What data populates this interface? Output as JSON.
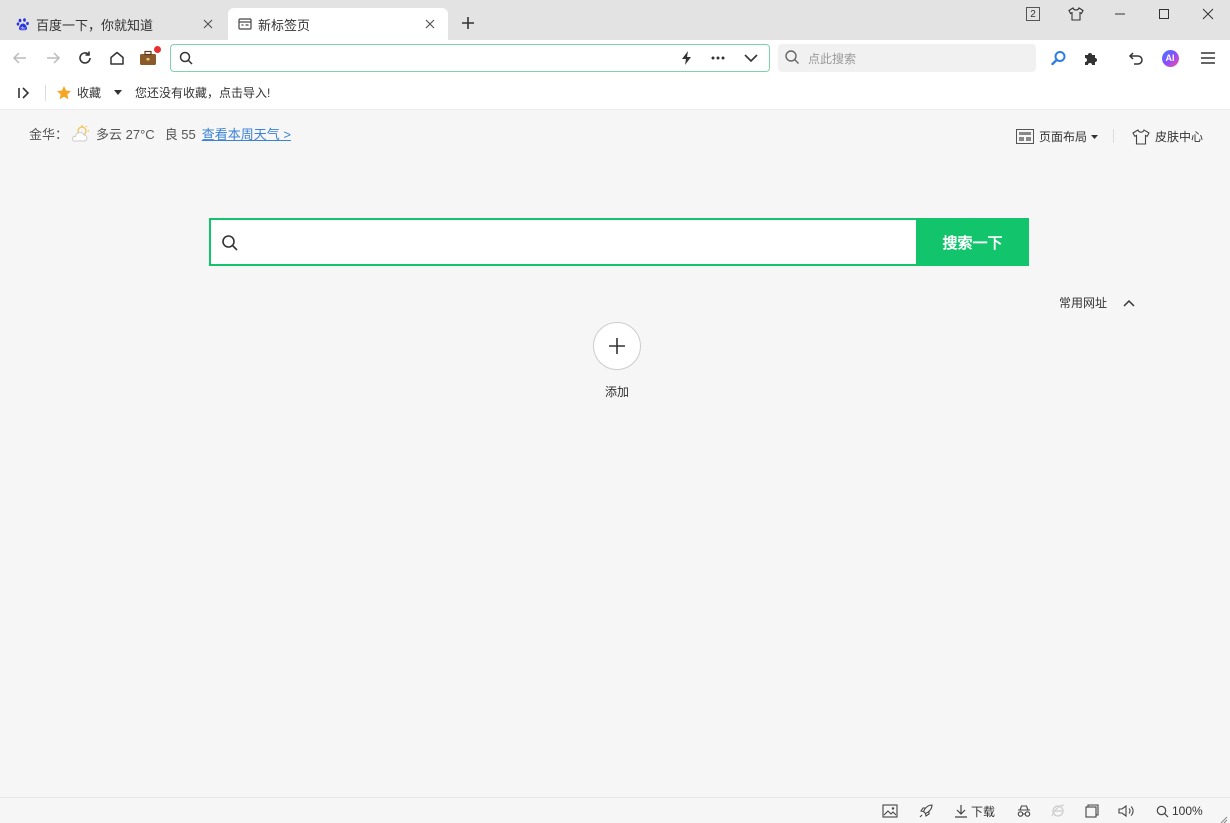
{
  "tabs": [
    {
      "title": "百度一下，你就知道",
      "active": false,
      "icon": "baidu-paw-icon"
    },
    {
      "title": "新标签页",
      "active": true,
      "icon": "newtab-page-icon"
    }
  ],
  "window": {
    "tab_count_badge": "2"
  },
  "toolbar": {
    "address_value": "",
    "side_search_placeholder": "点此搜索",
    "ai_label": "AI"
  },
  "bookmarks": {
    "favorites_label": "收藏",
    "empty_hint": "您还没有收藏，点击导入!"
  },
  "weather": {
    "city": "金华：",
    "condition": "多云 27°C",
    "air_quality": "良 55",
    "link": "查看本周天气 >"
  },
  "page_controls": {
    "layout_label": "页面布局",
    "skin_label": "皮肤中心"
  },
  "search": {
    "placeholder": "",
    "button_label": "搜索一下"
  },
  "frequent": {
    "toggle_label": "常用网址",
    "add_label": "添加"
  },
  "statusbar": {
    "download_label": "下载",
    "zoom": "100%"
  },
  "colors": {
    "accent_green": "#12c46b",
    "link_blue": "#3b82d6",
    "notification_red": "#e8312f"
  }
}
